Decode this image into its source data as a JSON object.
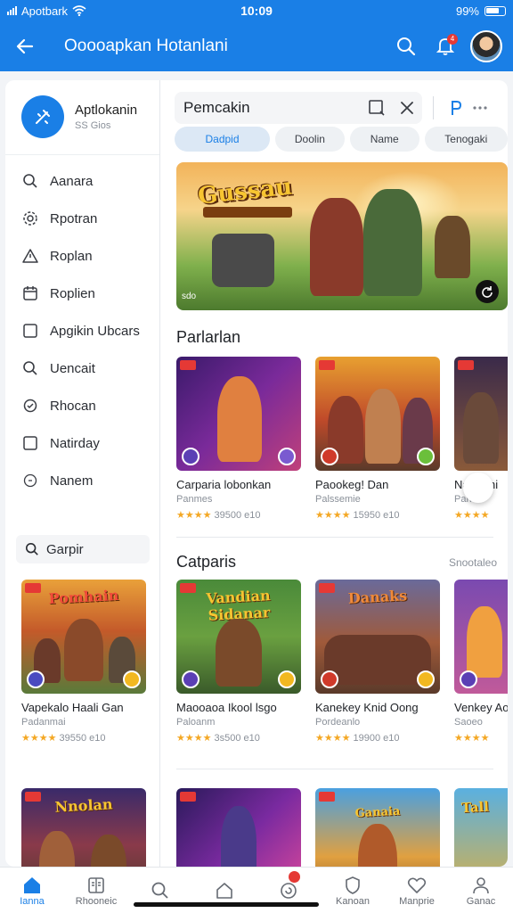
{
  "status": {
    "carrier": "Apotbark",
    "time": "10:09",
    "battery": "99%"
  },
  "appbar": {
    "title": "Ooooapkan Hotanlani",
    "back_icon": "arrow-left-icon",
    "notif_count": "4"
  },
  "sidebar": {
    "brand_name": "Aptlokanin",
    "brand_sub": "SS Gios",
    "items": [
      {
        "label": "Aanara",
        "icon": "search-icon"
      },
      {
        "label": "Rpotran",
        "icon": "gear-icon"
      },
      {
        "label": "Roplan",
        "icon": "warning-icon"
      },
      {
        "label": "Roplien",
        "icon": "calendar-icon"
      },
      {
        "label": "Apgikin Ubcars",
        "icon": "square-icon"
      },
      {
        "label": "Uencait",
        "icon": "search-icon"
      },
      {
        "label": "Rhocan",
        "icon": "sync-icon"
      },
      {
        "label": "Natirday",
        "icon": "square-icon"
      },
      {
        "label": "Nanem",
        "icon": "circle-icon"
      }
    ],
    "search_label": "Garpir"
  },
  "search": {
    "value": "Pemcakin"
  },
  "chips": [
    "Dadpid",
    "Doolin",
    "Name",
    "Tenogaki"
  ],
  "banner": {
    "title": "Gussau",
    "caption": "sdo"
  },
  "section1": {
    "title": "Parlarlan",
    "cards": [
      {
        "name": "Carparia lobonkan",
        "sub": "Panmes",
        "rating": "39500 e10"
      },
      {
        "name": "Paookeg! Dan",
        "sub": "Palssemie",
        "rating": "15950 e10"
      },
      {
        "name": "Nan Ami",
        "sub": "Parn",
        "rating": ""
      }
    ]
  },
  "section2": {
    "title": "Catparis",
    "see_all": "Snootaleo",
    "cards": [
      {
        "name": "Vapekalo Haali Gan",
        "sub": "Padanmai",
        "rating": "39550 e10",
        "thumb_title": "Pomhain"
      },
      {
        "name": "Maooaoa Ikool lsgo",
        "sub": "Paloanm",
        "rating": "3s500 e10",
        "thumb_title": "Vandian Sidanar"
      },
      {
        "name": "Kanekey Knid Oong",
        "sub": "Pordeanlo",
        "rating": "19900 e10",
        "thumb_title": "Danaks"
      },
      {
        "name": "Venkey Ao",
        "sub": "Saoeo",
        "rating": "",
        "thumb_title": ""
      }
    ]
  },
  "section3": {
    "thumb_titles": [
      "Nnolan",
      "",
      "Ganaia",
      "Tall"
    ]
  },
  "bottomnav": [
    {
      "label": "Ianna",
      "icon": "home-icon"
    },
    {
      "label": "Rhooneic",
      "icon": "book-icon"
    },
    {
      "label": "",
      "icon": "search-icon"
    },
    {
      "label": "",
      "icon": "home-outline-icon"
    },
    {
      "label": "",
      "icon": "refresh-icon"
    },
    {
      "label": "Kanoan",
      "icon": "shield-icon"
    },
    {
      "label": "Manprie",
      "icon": "heart-icon"
    },
    {
      "label": "Ganac",
      "icon": "user-icon"
    }
  ],
  "colors": {
    "primary": "#1a7fe6",
    "star": "#f4a825",
    "badge": "#e53935"
  }
}
